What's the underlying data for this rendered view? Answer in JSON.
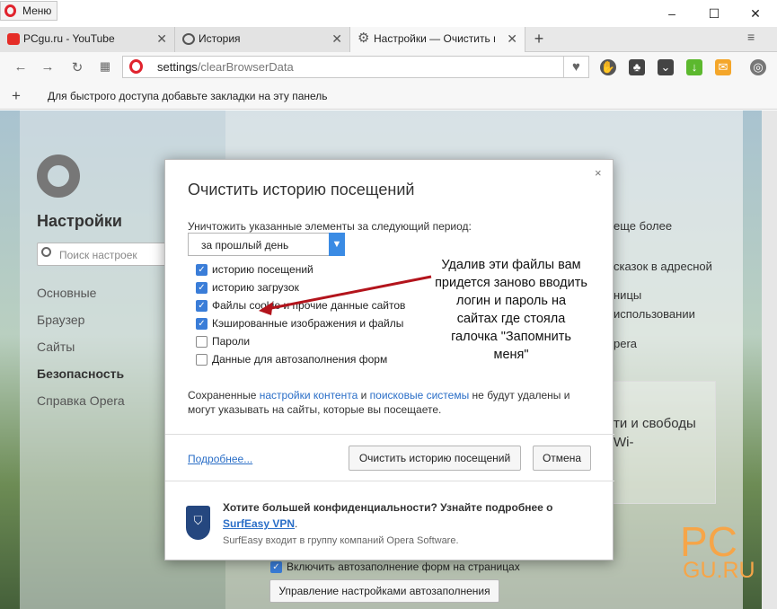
{
  "window": {
    "menu_label": "Меню",
    "controls": [
      "–",
      "☐",
      "✕"
    ]
  },
  "tabs": [
    {
      "label": "PCgu.ru - YouTube",
      "icon": "youtube-icon",
      "active": false
    },
    {
      "label": "История",
      "icon": "history-icon",
      "active": false
    },
    {
      "label": "Настройки — Очистить и",
      "icon": "settings-icon",
      "active": true
    }
  ],
  "tabbar": {
    "new_tab": "+",
    "menu": "≡"
  },
  "address": {
    "url_prefix": "settings",
    "url_path": "/clearBrowserData"
  },
  "bookmarks": {
    "add": "+",
    "hint": "Для быстрого доступа добавьте закладки на эту панель"
  },
  "settings": {
    "title": "Настройки",
    "search_placeholder": "Поиск настроек",
    "nav": [
      "Основные",
      "Браузер",
      "Сайты",
      "Безопасность",
      "Справка Opera"
    ],
    "selected_nav": "Безопасность"
  },
  "background": {
    "lines": [
      "еще более",
      "сказок в адресной",
      "ницы",
      "использовании",
      "pera",
      "ти и свободы",
      "Wi-"
    ],
    "autofill_checkbox": "Включить автозаполнение форм на страницах",
    "autofill_button": "Управление настройками автозаполнения"
  },
  "watermark": {
    "line1": "PC",
    "line2": "GU.RU"
  },
  "dialog": {
    "close": "×",
    "title": "Очистить историю посещений",
    "period_label": "Уничтожить указанные элементы за следующий период:",
    "period_value": "за прошлый день",
    "items": [
      {
        "label": "историю посещений",
        "checked": true
      },
      {
        "label": "историю загрузок",
        "checked": true
      },
      {
        "label": "Файлы cookie и прочие данные сайтов",
        "checked": true
      },
      {
        "label": "Кэшированные изображения и файлы",
        "checked": true
      },
      {
        "label": "Пароли",
        "checked": false
      },
      {
        "label": "Данные для автозаполнения форм",
        "checked": false
      }
    ],
    "annotation": "Удалив эти файлы вам придется заново вводить логин и пароль на сайтах где стояла галочка \"Запомнить меня\"",
    "note_pre": "Сохраненные ",
    "note_link1": "настройки контента",
    "note_mid": " и ",
    "note_link2": "поисковые системы",
    "note_post": " не будут удалены и могут указывать на сайты, которые вы посещаете.",
    "more_link": "Подробнее...",
    "clear_button": "Очистить историю посещений",
    "cancel_button": "Отмена",
    "vpn_question": "Хотите большей конфиденциальности? Узнайте подробнее о",
    "vpn_link": "SurfEasy VPN",
    "vpn_link_suffix": ".",
    "vpn_info": "SurfEasy входит в группу компаний Opera Software."
  }
}
